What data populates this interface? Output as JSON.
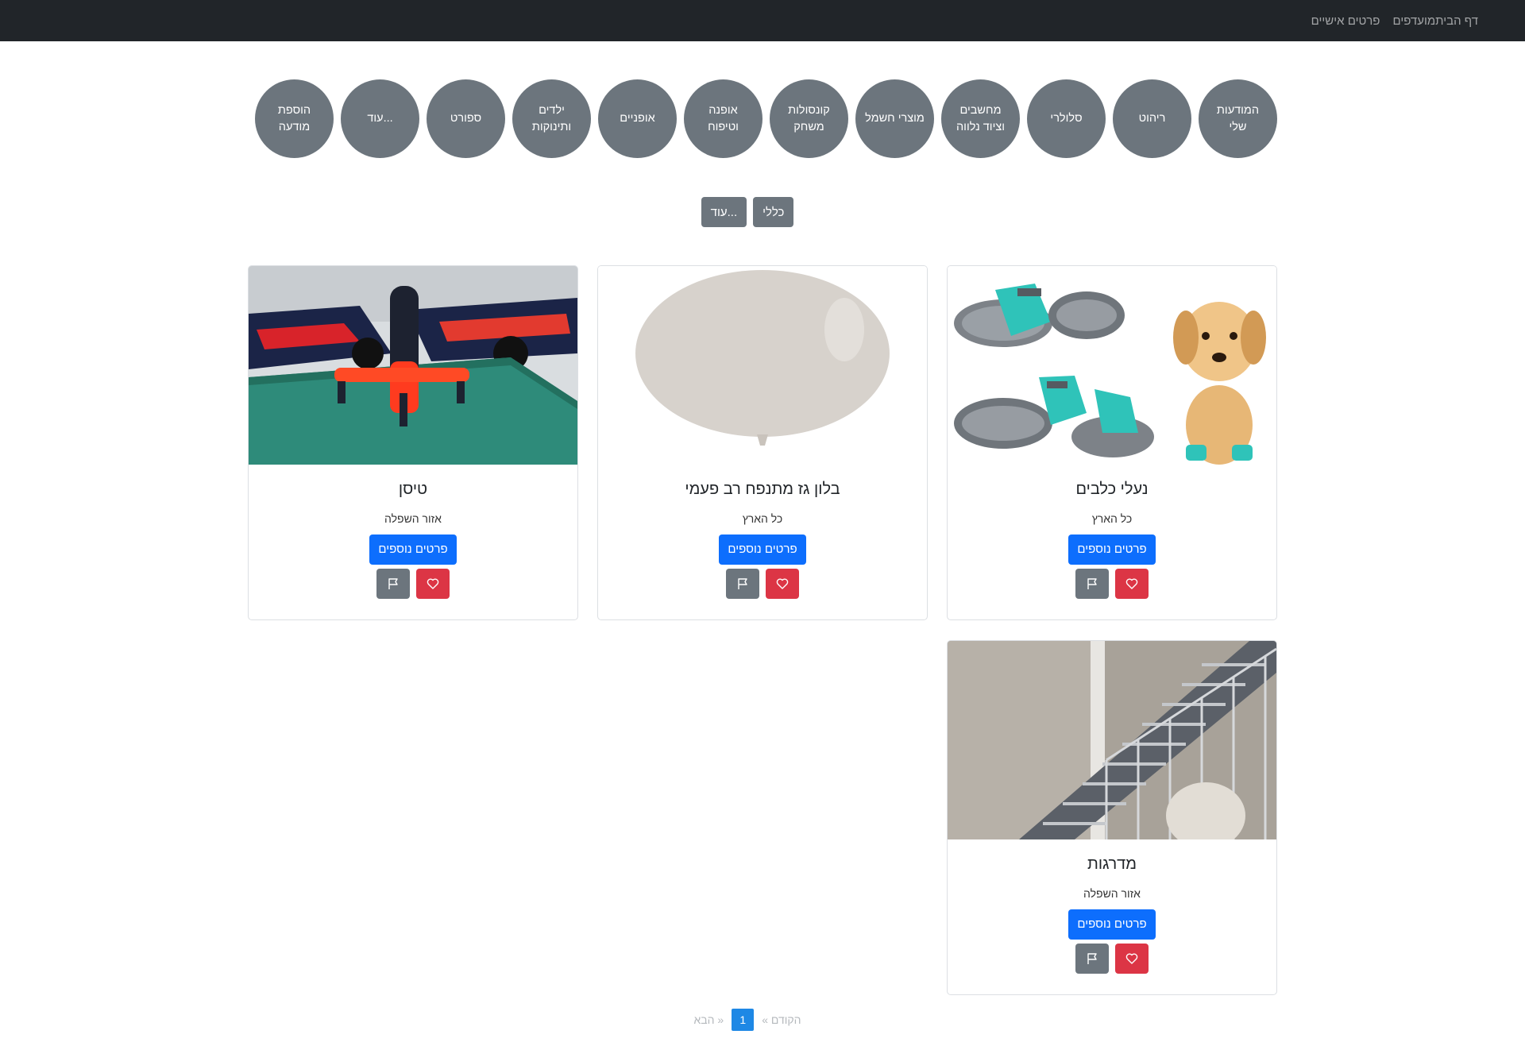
{
  "navbar": {
    "links": [
      "דף הבית",
      "מועדפים",
      "פרטים אישיים"
    ]
  },
  "categories": [
    "המודעות שלי",
    "ריהוט",
    "סלולרי",
    "מחשבים וציוד נלווה",
    "מוצרי חשמל",
    "קונסולות משחק",
    "אופנה וטיפוח",
    "אופניים",
    "ילדים ותינוקות",
    "ספורט",
    "עוד...",
    "הוספת מודעה"
  ],
  "subcategories": [
    "כללי",
    "עוד..."
  ],
  "cards": [
    {
      "title": "נעלי כלבים",
      "location": "כל הארץ",
      "details_label": "פרטים נוספים",
      "image_icon": "dog-shoes-photo"
    },
    {
      "title": "בלון גז מתנפח רב פעמי",
      "location": "כל הארץ",
      "details_label": "פרטים נוספים",
      "image_icon": "balloon-photo"
    },
    {
      "title": "טיסן",
      "location": "אזור השפלה",
      "details_label": "פרטים נוספים",
      "image_icon": "drone-photo"
    },
    {
      "title": "מדרגות",
      "location": "אזור השפלה",
      "details_label": "פרטים נוספים",
      "image_icon": "stairs-photo"
    }
  ],
  "pagination": {
    "prev_label": "« הקודם",
    "current": "1",
    "next_label": "הבא »"
  },
  "colors": {
    "navbar": "#212529",
    "category": "#6c757d",
    "primary": "#0d6efd",
    "danger": "#dc3545",
    "current_page": "#1e88e5"
  }
}
